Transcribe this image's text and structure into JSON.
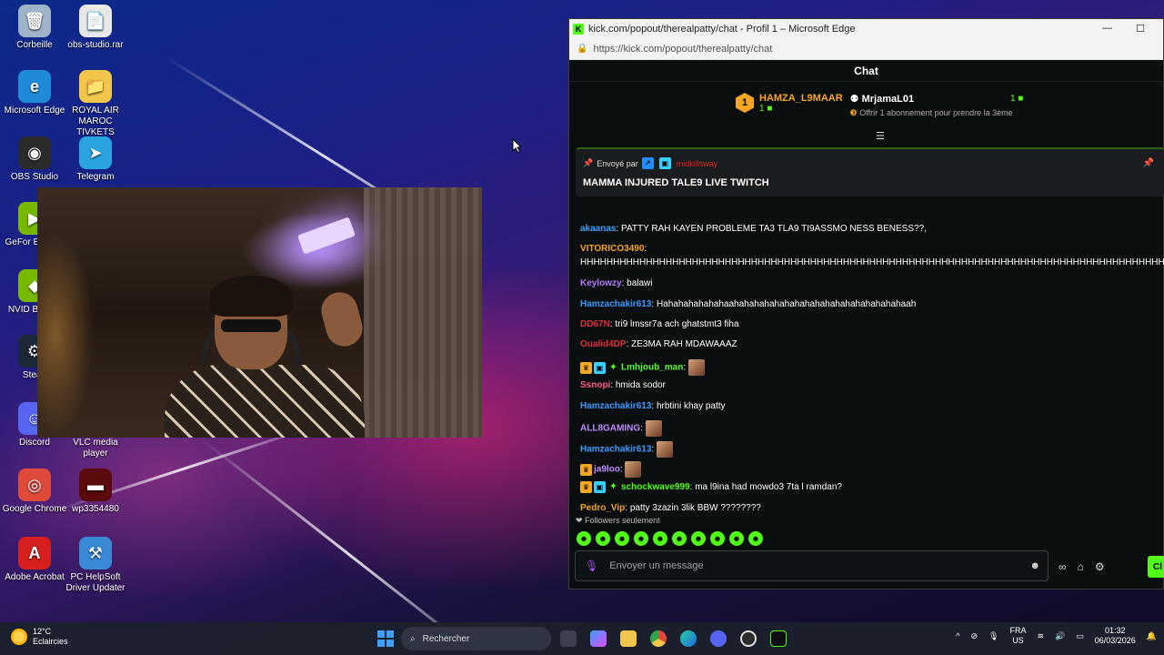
{
  "desktop": {
    "icons": [
      {
        "label": "Corbeille",
        "glyph": "🗑",
        "color": "#9fb4c8"
      },
      {
        "label": "obs-studio.rar",
        "glyph": "📄",
        "color": "#e8e8e8"
      },
      {
        "label": "Microsoft Edge",
        "glyph": "e",
        "color": "#1f8ad8"
      },
      {
        "label": "ROYAL AIR MAROC TIVKETS",
        "glyph": "📁",
        "color": "#f2c64a"
      },
      {
        "label": "OBS Studio",
        "glyph": "◉",
        "color": "#2b2b2b"
      },
      {
        "label": "Telegram",
        "glyph": "➤",
        "color": "#2aa3e0"
      },
      {
        "label": "GeFor Experie",
        "glyph": "▶",
        "color": "#76b900"
      },
      {
        "label": "NVID Broadc",
        "glyph": "◆",
        "color": "#76b900"
      },
      {
        "label": "Stean",
        "glyph": "⚙",
        "color": "#1b2838"
      },
      {
        "label": "Discord",
        "glyph": "☺",
        "color": "#5865f2"
      },
      {
        "label": "VLC media player",
        "glyph": "▲",
        "color": "#ff8800"
      },
      {
        "label": "Google Chrome",
        "glyph": "◎",
        "color": "#e04a3a"
      },
      {
        "label": "wp3354480",
        "glyph": "▬",
        "color": "#5a0a0a"
      },
      {
        "label": "Adobe Acrobat",
        "glyph": "A",
        "color": "#d81f1f"
      },
      {
        "label": "PC HelpSoft Driver Updater",
        "glyph": "⚒",
        "color": "#3a8ad8"
      }
    ]
  },
  "window": {
    "title": "kick.com/popout/therealpatty/chat - Profil 1 – Microsoft Edge",
    "url": "https://kick.com/popout/therealpatty/chat",
    "minimize": "—",
    "maximize": "☐"
  },
  "chat": {
    "header": "Chat",
    "top_gifter": {
      "rank": "1",
      "name": "HAMZA_L9MAAR",
      "count": "1 ■",
      "second_name": "MrjamaL01",
      "second_hint": "Offrir 1 abonnement pour prendre la 3ème",
      "second_count": "1 ■"
    },
    "pinned": {
      "sent_by_label": "Envoyé par",
      "sender": "midkillsway",
      "message": "MAMMA INJURED TALE9 LIVE TWITCH"
    },
    "messages": [
      {
        "user": "akaanas",
        "color": "#3aa0ff",
        "text": "PATTY RAH KAYEN PROBLEME TA3 TLA9 TI9ASSMO NESS BENESS??,",
        "badges": ""
      },
      {
        "user": "VITORICO3490",
        "color": "#f5a623",
        "text": "",
        "badges": ""
      },
      {
        "user": "",
        "color": "#ffffff",
        "text": "HHHHHHHHHHHHHHHHHHHHHHHHHHHHHHHHHHHHHHHHHHHHHHHHHHHHHHHHHHHHHHHHHHHHHHHHHHHHHHHHHHHHHHHHHHHHHH",
        "badges": ""
      },
      {
        "user": "Keylowzy",
        "color": "#b57aff",
        "text": "balawi",
        "badges": ""
      },
      {
        "user": "Hamzachakir613",
        "color": "#3a9bff",
        "text": "Hahahahahahahaahahahahahahahahahahahahahahahahahaah",
        "badges": ""
      },
      {
        "user": "DD67N",
        "color": "#e0303a",
        "text": "tri9 lmssr7a ach ghatstmt3 fiha",
        "badges": ""
      },
      {
        "user": "Oualid4DP",
        "color": "#e0303a",
        "text": "ZE3MA RAH MDAWAAAZ",
        "badges": ""
      },
      {
        "user": "Lmhjoub_man",
        "color": "#53fc18",
        "text": "",
        "badges": "crown,sub,vip",
        "emote": true
      },
      {
        "user": "Ssnopi",
        "color": "#ff5c8a",
        "text": "hmida sodor",
        "badges": ""
      },
      {
        "user": "Hamzachakir613",
        "color": "#3a9bff",
        "text": "hrbtini khay patty",
        "badges": ""
      },
      {
        "user": "ALL8GAMING",
        "color": "#c08aff",
        "text": "",
        "badges": "",
        "emote": true
      },
      {
        "user": "Hamzachakir613",
        "color": "#3a9bff",
        "text": "",
        "badges": "",
        "emote": true
      },
      {
        "user": "ja9loo",
        "color": "#c08aff",
        "text": "",
        "badges": "crown",
        "emote": true
      },
      {
        "user": "schockwave999",
        "color": "#53fc18",
        "text": "ma l9ina had mowdo3 7ta l ramdan?",
        "badges": "crown,sub,vip"
      },
      {
        "user": "Pedro_Vip",
        "color": "#f5a623",
        "text": "patty 3zazin 3lik BBW ????????",
        "badges": ""
      }
    ],
    "followers_only": "Followers seulement",
    "input_placeholder": "Envoyer un message",
    "send_label": "Cl"
  },
  "taskbar": {
    "weather_temp": "12°C",
    "weather_desc": "Eclaircies",
    "search_placeholder": "Rechercher",
    "lang_top": "FRA",
    "lang_bottom": "US",
    "time": "01:32",
    "date": "06/03/2026"
  },
  "colors": {
    "kick_green": "#53fc18",
    "window_bg": "#0b0e0f",
    "taskbar_bg": "#1c202c"
  }
}
